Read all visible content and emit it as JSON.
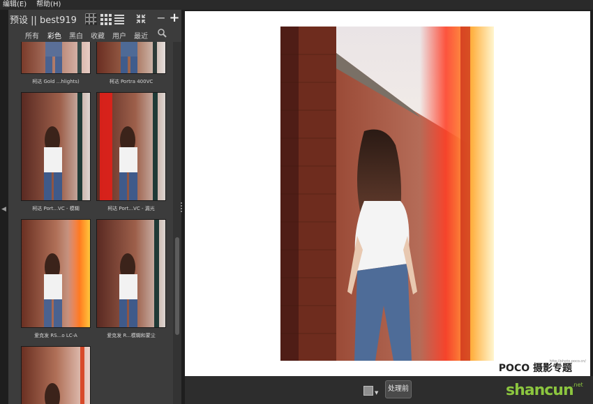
{
  "menubar": {
    "items": [
      "编辑(E)",
      "帮助(H)"
    ]
  },
  "left_panel": {
    "title": "预设 || best919",
    "view_buttons": [
      "grid-large-icon",
      "grid-small-icon",
      "list-icon",
      "expand-icon",
      "minus-icon",
      "plus-icon"
    ],
    "tabs": [
      "所有",
      "彩色",
      "黑白",
      "收藏",
      "用户",
      "最近"
    ],
    "active_tab": "彩色",
    "search_icon": "search-icon",
    "thumbnails": [
      {
        "caption": "柯达 Gold ...hlights)",
        "variant": "plain"
      },
      {
        "caption": "柯达 Portra 400VC",
        "variant": "plain"
      },
      {
        "caption": "柯达 Port...VC - 模糊",
        "variant": "plain"
      },
      {
        "caption": "柯达 Port...VC - 漏光",
        "variant": "leak-left"
      },
      {
        "caption": "爱克发 RS...o LC-A",
        "variant": "leak-right"
      },
      {
        "caption": "爱克发 R...模糊和蒙尘",
        "variant": "plain"
      },
      {
        "caption": "",
        "variant": "leak-right"
      }
    ]
  },
  "canvas": {
    "watermark": "POCO 摄影专题",
    "watermark_sub": "http://photo.poco.cn/"
  },
  "bottom_bar": {
    "before_button": "处理前",
    "logo_text": "shancun",
    "logo_suffix": ".net"
  },
  "colors": {
    "panel_bg": "#3c3c3c",
    "app_bg": "#1e1e1e",
    "accent_green": "#8cc63f"
  }
}
